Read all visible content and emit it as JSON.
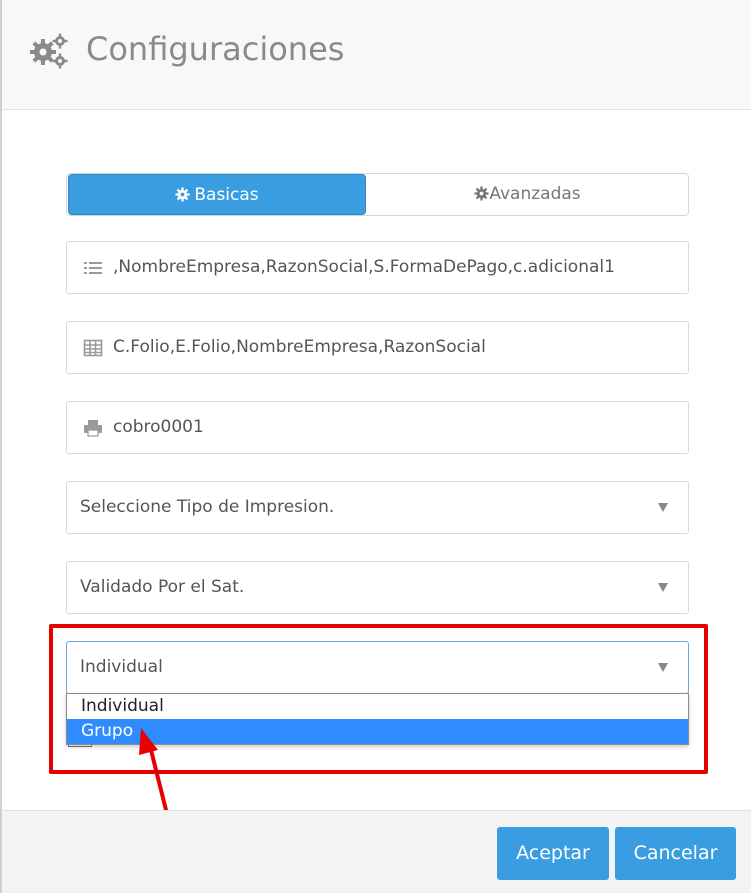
{
  "header": {
    "title": "Configuraciones",
    "icon": "gears-icon"
  },
  "tabs": [
    {
      "label": "Basicas",
      "active": true,
      "icon": "gear-icon"
    },
    {
      "label": "Avanzadas",
      "active": false,
      "icon": "gear-icon"
    }
  ],
  "fields": {
    "columns_list": {
      "icon": "list-icon",
      "value": ",NombreEmpresa,RazonSocial,S.FormaDePago,c.adicional1"
    },
    "order_fields": {
      "icon": "table-icon",
      "value": "C.Folio,E.Folio,NombreEmpresa,RazonSocial"
    },
    "printer": {
      "icon": "printer-icon",
      "value": "cobro0001"
    }
  },
  "selects": {
    "print_type": {
      "value": "Seleccione Tipo de Impresion."
    },
    "validation": {
      "value": "Validado Por el Sat."
    },
    "grouping": {
      "value": "Individual",
      "options": [
        "Individual",
        "Grupo"
      ],
      "highlighted": "Grupo"
    }
  },
  "footer": {
    "accept_label": "Aceptar",
    "cancel_label": "Cancelar"
  },
  "colors": {
    "accent": "#3a9de2",
    "highlight": "#e60000",
    "option_selected": "#2f8cff"
  }
}
